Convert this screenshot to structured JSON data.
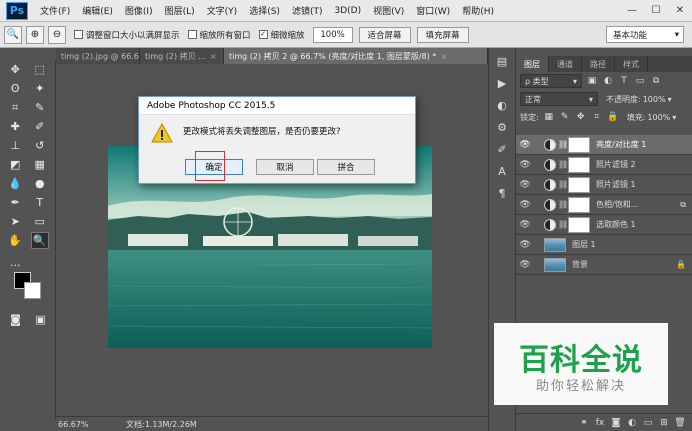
{
  "app": {
    "logo": "Ps",
    "menu": [
      "文件(F)",
      "编辑(E)",
      "图像(I)",
      "图层(L)",
      "文字(Y)",
      "选择(S)",
      "滤镜(T)",
      "3D(D)",
      "视图(V)",
      "窗口(W)",
      "帮助(H)"
    ],
    "window_controls": [
      "—",
      "☐",
      "✕"
    ]
  },
  "options": {
    "check_resize": "调整窗口大小以满屏显示",
    "check_all_windows": "缩放所有窗口",
    "check_scrubby": "细微缩放",
    "zoom_value": "100%",
    "fit_screen": "适合屏幕",
    "fill_screen": "填充屏幕",
    "workspace": "基本功能"
  },
  "tabs": [
    {
      "label": "timg (2).jpg @ 66.6...",
      "active": false
    },
    {
      "label": "timg (2) 拷贝 ...",
      "active": false
    },
    {
      "label": "timg (2) 拷贝 2 @ 66.7% (亮度/对比度 1, 图层蒙版/8) *",
      "active": true
    }
  ],
  "status": {
    "zoom": "66.67%",
    "doc": "文档:1.13M/2.26M"
  },
  "layers_panel": {
    "tabs": [
      "图层",
      "通道",
      "路径",
      "样式"
    ],
    "filter_kind": "ρ 类型",
    "blend_mode": "正常",
    "opacity_label": "不透明度:",
    "opacity_value": "100%",
    "lock_label": "锁定:",
    "fill_label": "填充:",
    "fill_value": "100%",
    "layers": [
      {
        "name": "亮度/对比度 1",
        "kind": "adjustment",
        "selected": true,
        "end": ""
      },
      {
        "name": "照片滤镜 2",
        "kind": "adjustment",
        "selected": false,
        "end": ""
      },
      {
        "name": "照片滤镜 1",
        "kind": "adjustment",
        "selected": false,
        "end": ""
      },
      {
        "name": "色相/饱和...",
        "kind": "adjustment",
        "selected": false,
        "end": "⧉"
      },
      {
        "name": "选取颜色 1",
        "kind": "adjustment",
        "selected": false,
        "end": ""
      },
      {
        "name": "图层 1",
        "kind": "image",
        "selected": false,
        "end": ""
      },
      {
        "name": "背景",
        "kind": "image",
        "selected": false,
        "end": "🔒"
      }
    ]
  },
  "dialog": {
    "title": "Adobe Photoshop CC 2015.5",
    "message": "更改模式将丢失调整图层，是否仍要更改?",
    "ok": "确定",
    "cancel": "取消",
    "flatten": "拼合"
  },
  "watermark": {
    "title": "百科全说",
    "subtitle": "助你轻松解决"
  },
  "colors": {
    "foreground": "#000000",
    "background": "#ffffff"
  }
}
